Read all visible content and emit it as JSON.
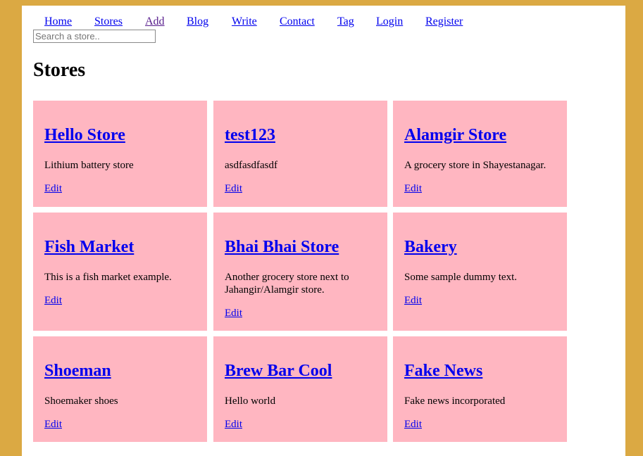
{
  "nav": {
    "items": [
      {
        "label": "Home"
      },
      {
        "label": "Stores"
      },
      {
        "label": "Add"
      },
      {
        "label": "Blog"
      },
      {
        "label": "Write"
      },
      {
        "label": "Contact"
      },
      {
        "label": "Tag"
      },
      {
        "label": "Login"
      },
      {
        "label": "Register"
      }
    ]
  },
  "search": {
    "placeholder": "Search a store..",
    "value": ""
  },
  "page_title": "Stores",
  "stores": [
    {
      "name": "Hello Store",
      "description": "Lithium battery store",
      "edit_label": "Edit"
    },
    {
      "name": "test123",
      "description": "asdfasdfasdf",
      "edit_label": "Edit"
    },
    {
      "name": "Alamgir Store",
      "description": "A grocery store in Shayestanagar.",
      "edit_label": "Edit"
    },
    {
      "name": "Fish Market",
      "description": "This is a fish market example.",
      "edit_label": "Edit"
    },
    {
      "name": "Bhai Bhai Store",
      "description": "Another grocery store next to Jahangir/Alamgir store.",
      "edit_label": "Edit"
    },
    {
      "name": "Bakery",
      "description": "Some sample dummy text.",
      "edit_label": "Edit"
    },
    {
      "name": "Shoeman",
      "description": "Shoemaker shoes",
      "edit_label": "Edit"
    },
    {
      "name": "Brew Bar Cool",
      "description": "Hello world",
      "edit_label": "Edit"
    },
    {
      "name": "Fake News",
      "description": "Fake news incorporated",
      "edit_label": "Edit"
    }
  ],
  "colors": {
    "background": "#dba943",
    "card": "#ffb6c1",
    "link": "#0000ee",
    "visited_link": "#551a8b"
  }
}
